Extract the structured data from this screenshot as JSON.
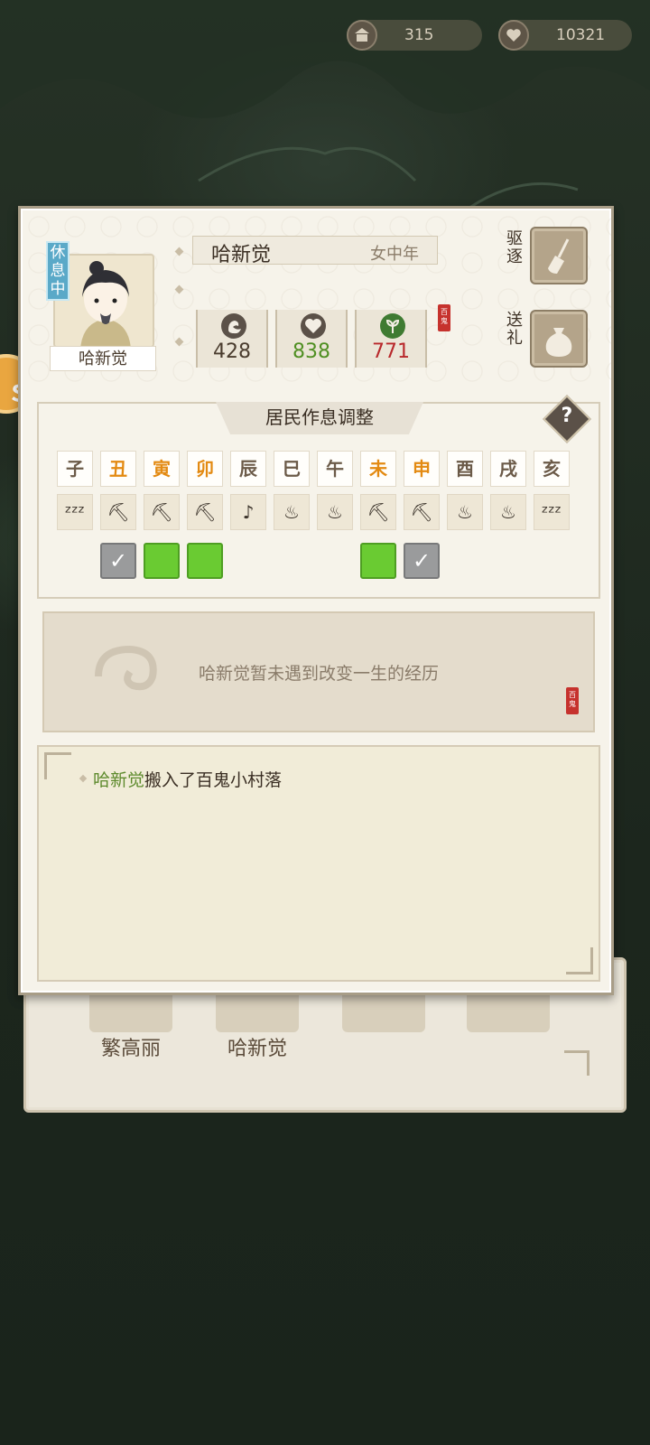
{
  "currency": {
    "a_value": "315",
    "b_value": "10321"
  },
  "background": {
    "names": [
      "繁高丽",
      "哈新觉"
    ]
  },
  "resident": {
    "status": "休息中",
    "name": "哈新觉",
    "name_plate": "哈新觉",
    "category": "女中年",
    "stats": [
      {
        "icon": "strength-icon",
        "value": "428",
        "color": "#4a3c2e"
      },
      {
        "icon": "heart-icon",
        "value": "838",
        "color": "#4f8f22"
      },
      {
        "icon": "sprout-icon",
        "value": "771",
        "color": "#b8282b"
      }
    ],
    "seal_text": "百鬼"
  },
  "actions": {
    "expel_label": "驱逐",
    "gift_label": "送礼"
  },
  "schedule": {
    "title": "居民作息调整",
    "help_label": "?",
    "hours": [
      {
        "label": "子",
        "color": "#6b5a48"
      },
      {
        "label": "丑",
        "color": "#e38a12"
      },
      {
        "label": "寅",
        "color": "#e38a12"
      },
      {
        "label": "卯",
        "color": "#e38a12"
      },
      {
        "label": "辰",
        "color": "#6b5a48"
      },
      {
        "label": "巳",
        "color": "#6b5a48"
      },
      {
        "label": "午",
        "color": "#6b5a48"
      },
      {
        "label": "未",
        "color": "#e38a12"
      },
      {
        "label": "申",
        "color": "#e38a12"
      },
      {
        "label": "酉",
        "color": "#6b5a48"
      },
      {
        "label": "戌",
        "color": "#6b5a48"
      },
      {
        "label": "亥",
        "color": "#6b5a48"
      }
    ],
    "activities": [
      "sleep-icon",
      "pickaxe-icon",
      "pickaxe-icon",
      "pickaxe-icon",
      "music-person-icon",
      "food-bowl-icon",
      "food-bowl-icon",
      "pickaxe-icon",
      "pickaxe-icon",
      "food-bowl-icon",
      "food-bowl-icon",
      "sleep-icon"
    ],
    "toggles": [
      "none",
      "checked",
      "green",
      "green",
      "none",
      "none",
      "none",
      "green",
      "checked",
      "none",
      "none",
      "none"
    ]
  },
  "story": {
    "text": "哈新觉暂未遇到改变一生的经历",
    "seal_text": "百鬼"
  },
  "log": {
    "name": "哈新觉",
    "text": "搬入了百鬼小村落"
  }
}
